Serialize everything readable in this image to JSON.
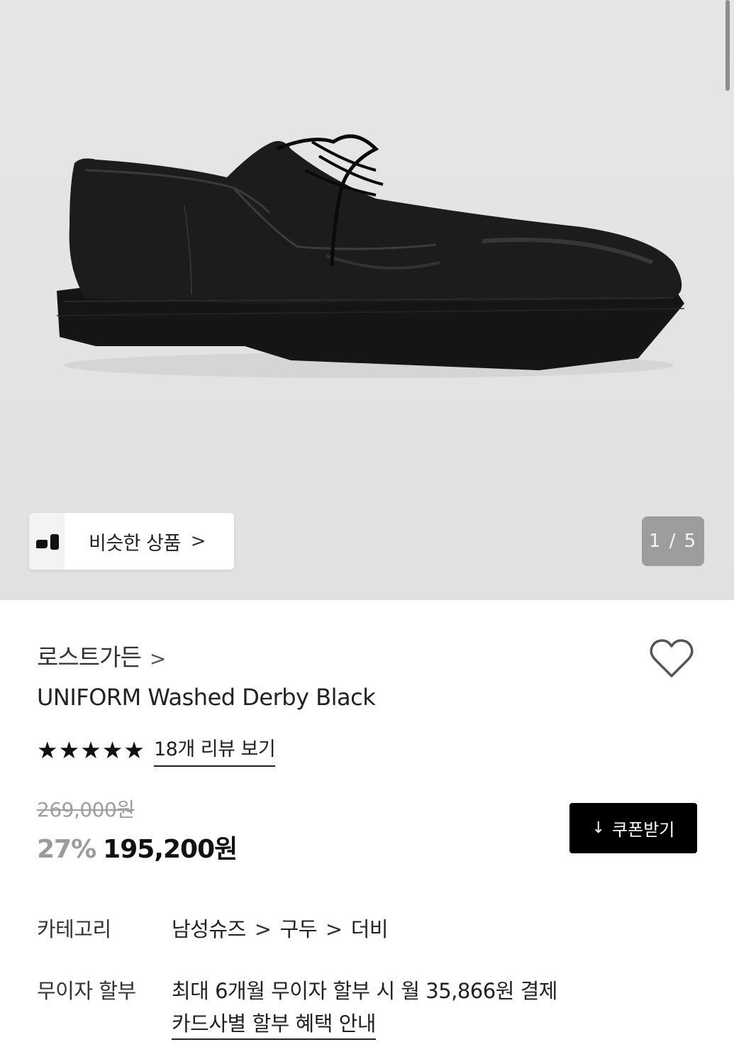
{
  "gallery": {
    "similar_label": "비슷한 상품",
    "similar_chevron": ">",
    "counter": "1 / 5"
  },
  "product": {
    "brand": "로스트가든",
    "brand_chevron": ">",
    "title": "UNIFORM Washed Derby Black",
    "stars": [
      "★",
      "★",
      "★",
      "★",
      "★"
    ],
    "review_link": "18개 리뷰 보기",
    "original_price": "269,000원",
    "discount": "27%",
    "sale_price": "195,200원",
    "coupon_label": "쿠폰받기",
    "coupon_icon": "↓"
  },
  "info": {
    "category_label": "카테고리",
    "categories": [
      "남성슈즈",
      "구두",
      "더비"
    ],
    "separator": ">",
    "installment_label": "무이자 할부",
    "installment_text": "최대 6개월 무이자 할부 시 월 35,866원 결제",
    "card_link": "카드사별 할부 혜택 안내"
  }
}
